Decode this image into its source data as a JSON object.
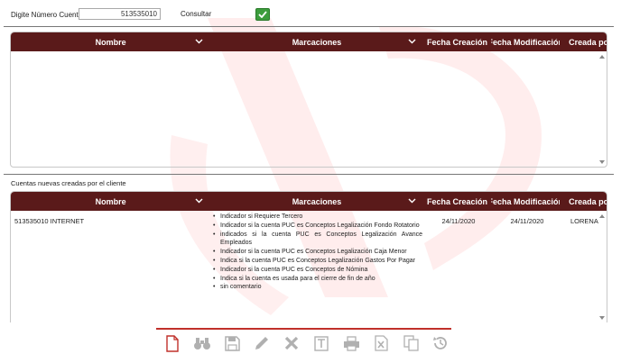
{
  "search": {
    "label": "Digite Número Cuenta",
    "account_value": "513535010",
    "consultar_label": "Consultar"
  },
  "grid_top": {
    "columns": [
      "Nombre",
      "Marcaciones",
      "Fecha Creación",
      "Fecha Modificación",
      "Creada por"
    ],
    "rows": []
  },
  "section": {
    "title": "Cuentas nuevas creadas por el cliente"
  },
  "grid_bottom": {
    "columns": [
      "Nombre",
      "Marcaciones",
      "Fecha Creación",
      "Fecha Modificación",
      "Creada por"
    ],
    "rows": [
      {
        "nombre": "513535010 INTERNET",
        "marcaciones": [
          "Indicador si Requiere Tercero",
          "Indicador si la cuenta PUC es Conceptos Legalización Fondo Rotatorio",
          "indicados si la cuenta PUC es Conceptos Legalización Avance Empleados",
          "Indicador si la cuenta PUC es Conceptos Legalización Caja Menor",
          "Indica si la cuenta PUC es Conceptos Legalización Gastos Por Pagar",
          "Indicador si la cuenta PUC es Conceptos de Nómina",
          "Indica si la cuenta es usada para el cierre de fin de año",
          "sin comentario"
        ],
        "fecha_creacion": "24/11/2020",
        "fecha_modificacion": "24/11/2020",
        "creada_por": "LORENA FI"
      }
    ]
  },
  "toolbar": {
    "items": [
      "new-document-icon",
      "binoculars-icon",
      "save-icon",
      "edit-pencil-icon",
      "delete-x-icon",
      "text-t-icon",
      "print-icon",
      "excel-icon",
      "copy-icon",
      "history-icon"
    ]
  },
  "colors": {
    "header_bg": "#5a1a1a",
    "accent_line": "#c0302a",
    "check_green": "#3c9c3c"
  }
}
